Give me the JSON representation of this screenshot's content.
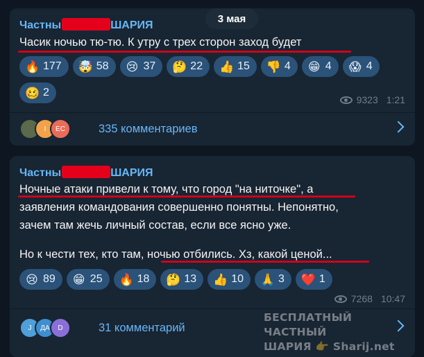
{
  "date_pill": "3 мая",
  "posts": [
    {
      "channel_prefix": "Частны",
      "channel_suffix": "ШАРИЯ",
      "lines": [
        "Часик ночью тю-тю. К утру с трех сторон заход будет"
      ],
      "reactions": [
        {
          "emoji": "🔥",
          "count": "177"
        },
        {
          "emoji": "🤯",
          "count": "58"
        },
        {
          "emoji": "😢",
          "count": "37"
        },
        {
          "emoji": "🤔",
          "count": "22"
        },
        {
          "emoji": "👍",
          "count": "15"
        },
        {
          "emoji": "👎",
          "count": "4"
        },
        {
          "emoji": "😁",
          "count": "4"
        },
        {
          "emoji": "😱",
          "count": "4"
        },
        {
          "emoji": "🥴",
          "count": "2"
        }
      ],
      "views": "9323",
      "time": "1:21",
      "avatars": [
        {
          "label": "",
          "color": "#5a6a4a"
        },
        {
          "label": "I",
          "color": "#f3a24a"
        },
        {
          "label": "ЕС",
          "color": "#e86c5a"
        }
      ],
      "comments": "335 комментариев"
    },
    {
      "channel_prefix": "Частны",
      "channel_suffix": "ШАРИЯ",
      "lines": [
        "Ночные атаки привели к тому, что город \"на ниточке\", а",
        "заявления командования совершенно понятны. Непонятно,",
        "зачем там жечь личный состав, если все ясно уже.",
        "",
        "Но к чести тех, кто там, ночью отбились. Хз, какой ценой..."
      ],
      "reactions": [
        {
          "emoji": "😢",
          "count": "89"
        },
        {
          "emoji": "😁",
          "count": "25"
        },
        {
          "emoji": "🔥",
          "count": "18"
        },
        {
          "emoji": "🤔",
          "count": "13"
        },
        {
          "emoji": "👍",
          "count": "10"
        },
        {
          "emoji": "🙏",
          "count": "3"
        },
        {
          "emoji": "❤️",
          "count": "1"
        }
      ],
      "views": "7268",
      "time": "10:47",
      "avatars": [
        {
          "label": "J",
          "color": "#4f9fd8"
        },
        {
          "label": "ДА",
          "color": "#3d8fd0"
        },
        {
          "label": "D",
          "color": "#8a6fd8"
        }
      ],
      "comments": "31 комментарий"
    }
  ],
  "watermark": {
    "line1": "БЕСПЛАТНЫЙ ЧАСТНЫЙ",
    "line2": "ШАРИЯ 👉 Sharij.net"
  },
  "colors": {
    "background": "#0e1621",
    "bubble": "#182533",
    "accent": "#67b7f7",
    "chip": "#2b5278",
    "underline": "#d0021b",
    "redaction": "#e4001b"
  },
  "icons": [
    "eye-icon",
    "chevron-right-icon"
  ]
}
